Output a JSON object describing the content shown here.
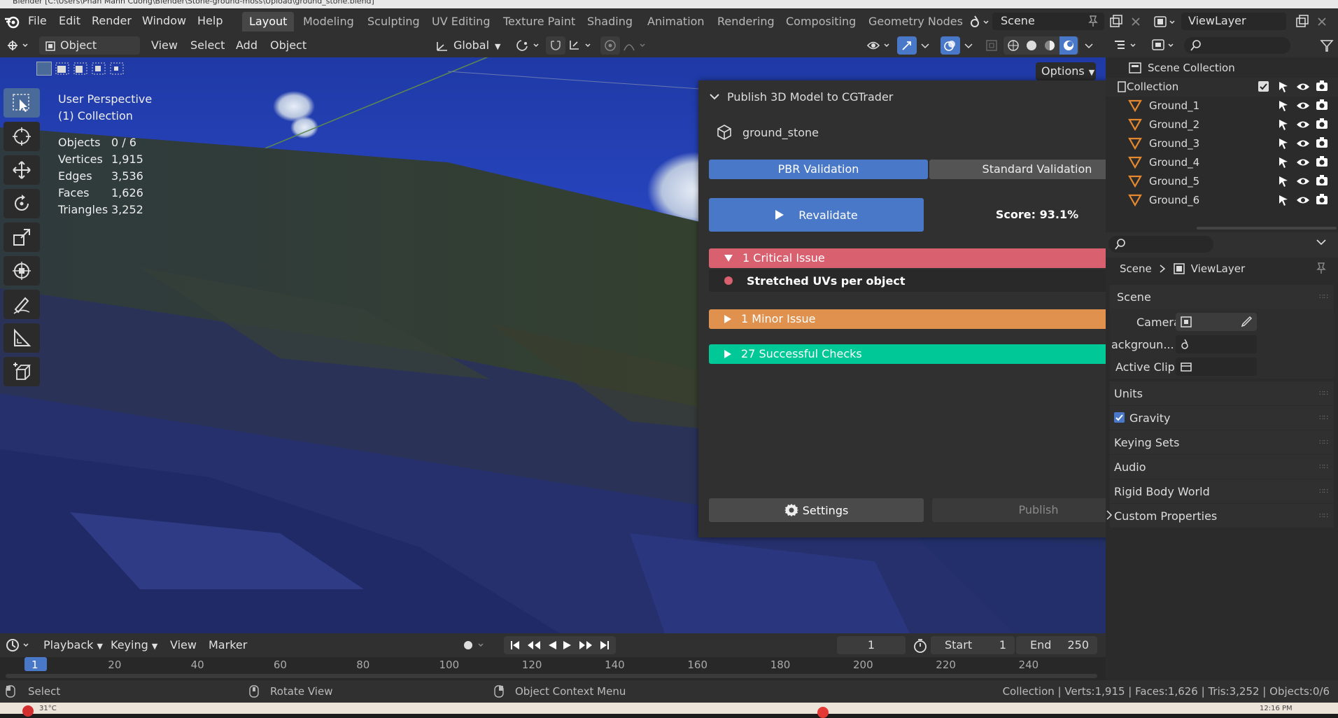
{
  "window": {
    "title": "Blender [C:\\Users\\Phan Manh Cuong\\Blender\\Stone-ground-moss\\Upload\\ground_stone.blend]"
  },
  "menu": [
    "File",
    "Edit",
    "Render",
    "Window",
    "Help"
  ],
  "workspaces": [
    "Layout",
    "Modeling",
    "Sculpting",
    "UV Editing",
    "Texture Paint",
    "Shading",
    "Animation",
    "Rendering",
    "Compositing",
    "Geometry Nodes"
  ],
  "scene_field": "Scene",
  "viewlayer_field": "ViewLayer",
  "header": {
    "mode": "Object Mode",
    "view": "View",
    "select": "Select",
    "add": "Add",
    "object": "Object",
    "orientation": "Global",
    "options": "Options"
  },
  "viewport": {
    "perspective": "User Perspective",
    "collection": "(1) Collection",
    "stats": [
      {
        "label": "Objects",
        "value": "0 / 6"
      },
      {
        "label": "Vertices",
        "value": "1,915"
      },
      {
        "label": "Edges",
        "value": "3,536"
      },
      {
        "label": "Faces",
        "value": "1,626"
      },
      {
        "label": "Triangles",
        "value": "3,252"
      }
    ]
  },
  "panel": {
    "title": "Publish 3D Model to CGTrader",
    "model_name": "ground_stone",
    "tab_pbr": "PBR Validation",
    "tab_standard": "Standard Validation",
    "revalidate": "Revalidate",
    "score": "Score: 93.1%",
    "critical": "1 Critical Issue",
    "critical_item": "Stretched UVs per object",
    "minor": "1 Minor Issue",
    "successful": "27 Successful Checks",
    "settings": "Settings",
    "publish": "Publish",
    "colors": {
      "critical": "#d9606f",
      "minor": "#e0914e",
      "success": "#00c896",
      "accent": "#4a78c8"
    }
  },
  "outliner": {
    "root": "Scene Collection",
    "collection": "Collection",
    "items": [
      "Ground_1",
      "Ground_2",
      "Ground_3",
      "Ground_4",
      "Ground_5",
      "Ground_6"
    ]
  },
  "properties": {
    "breadcrumb_scene": "Scene",
    "breadcrumb_layer": "ViewLayer",
    "section_scene": "Scene",
    "camera_label": "Camera",
    "background_label": "ackgroun...",
    "active_clip_label": "Active Clip",
    "units": "Units",
    "gravity": "Gravity",
    "keying_sets": "Keying Sets",
    "audio": "Audio",
    "rigid_body": "Rigid Body World",
    "custom_props": "Custom Properties"
  },
  "timeline": {
    "playback": "Playback",
    "keying": "Keying",
    "view": "View",
    "marker": "Marker",
    "current_frame": "1",
    "start_label": "Start",
    "start": "1",
    "end_label": "End",
    "end": "250",
    "ticks": [
      "1",
      "20",
      "40",
      "60",
      "80",
      "100",
      "120",
      "140",
      "160",
      "180",
      "200",
      "220",
      "240"
    ]
  },
  "status": {
    "select": "Select",
    "rotate": "Rotate View",
    "context": "Object Context Menu",
    "stats": "Collection | Verts:1,915 | Faces:1,626 | Tris:3,252 | Objects:0/6"
  },
  "taskbar": {
    "temp": "31°C",
    "time": "12:16 PM"
  }
}
